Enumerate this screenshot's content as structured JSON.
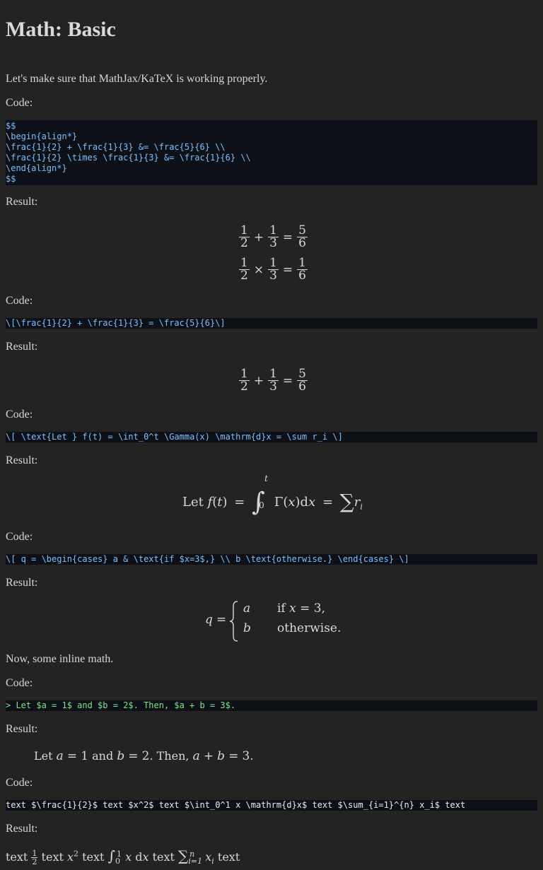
{
  "title": "Math: Basic",
  "intro": "Let's make sure that MathJax/KaTeX is working properly.",
  "labels": {
    "code": "Code:",
    "result": "Result:",
    "inline_intro": "Now, some inline math."
  },
  "block1": {
    "code_lines": [
      "$$",
      "\\begin{align*}",
      "\\frac{1}{2} + \\frac{1}{3} &= \\frac{5}{6} \\\\",
      "\\frac{1}{2} \\times \\frac{1}{3} &= \\frac{1}{6} \\\\",
      "\\end{align*}",
      "$$"
    ],
    "row1": {
      "a_num": "1",
      "a_den": "2",
      "op": "+",
      "b_num": "1",
      "b_den": "3",
      "eq": "=",
      "c_num": "5",
      "c_den": "6"
    },
    "row2": {
      "a_num": "1",
      "a_den": "2",
      "op": "×",
      "b_num": "1",
      "b_den": "3",
      "eq": "=",
      "c_num": "1",
      "c_den": "6"
    }
  },
  "block2": {
    "code": "\\[\\frac{1}{2} + \\frac{1}{3} = \\frac{5}{6}\\]",
    "row": {
      "a_num": "1",
      "a_den": "2",
      "op": "+",
      "b_num": "1",
      "b_den": "3",
      "eq": "=",
      "c_num": "5",
      "c_den": "6"
    }
  },
  "block3": {
    "code": "\\[ \\text{Let } f(t) = \\int_0^t \\Gamma(x) \\mathrm{d}x = \\sum r_i \\]",
    "let": "Let",
    "f": "f",
    "t": "t",
    "eq": "=",
    "upper": "t",
    "lower": "0",
    "gamma": "Γ",
    "x": "x",
    "d": "d",
    "r": "r",
    "i": "i"
  },
  "block4": {
    "code": "\\[ q = \\begin{cases} a & \\text{if $x=3$,} \\\\ b \\text{otherwise.} \\end{cases} \\]",
    "q": "q",
    "eq": "=",
    "case1_var": "a",
    "case1_if": "if",
    "case1_cond": "x",
    "case1_eq": "=",
    "case1_val": "3,",
    "case2_var": "b",
    "case2_text": "otherwise."
  },
  "block5": {
    "code": "> Let $a = 1$ and $b = 2$. Then, $a + b = 3$.",
    "let": "Let",
    "a": "a",
    "eq": "=",
    "one": "1",
    "and": "and",
    "b": "b",
    "two": "2",
    "then": ". Then,",
    "plus": "+",
    "three": "3",
    "period": "."
  },
  "block6": {
    "code": "text $\\frac{1}{2}$ text $x^2$ text $\\int_0^1 x \\mathrm{d}x$ text $\\sum_{i=1}^{n} x_i$ text",
    "text": "text",
    "half_num": "1",
    "half_den": "2",
    "x": "x",
    "sq": "2",
    "int_upper": "1",
    "int_lower": "0",
    "d": "d",
    "sum_upper": "n",
    "sum_lower": "i=1",
    "i": "i"
  }
}
